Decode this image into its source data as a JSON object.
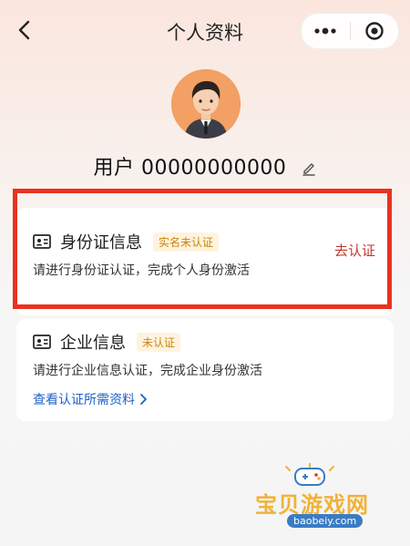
{
  "header": {
    "title": "个人资料"
  },
  "profile": {
    "user_label": "用户 00000000000"
  },
  "cards": [
    {
      "title": "身份证信息",
      "badge": "实名未认证",
      "desc": "请进行身份证认证，完成个人身份激活",
      "action": "去认证"
    },
    {
      "title": "企业信息",
      "badge": "未认证",
      "desc": "请进行企业信息认证，完成企业身份激活",
      "link": "查看认证所需资料"
    }
  ],
  "watermark": {
    "text": "宝贝游戏网",
    "sub": "baobeiy.com"
  },
  "colors": {
    "accent": "#e8321f",
    "badge_text": "#c8860c",
    "link": "#1e61c7",
    "action": "#c0392b"
  }
}
